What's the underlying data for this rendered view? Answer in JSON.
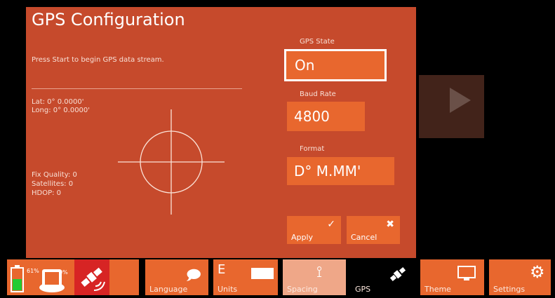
{
  "dialog": {
    "title": "GPS Configuration",
    "intro": "Press Start to begin GPS data stream.",
    "lat": "Lat: 0° 0.0000'",
    "long": "Long: 0° 0.0000'",
    "fix_quality": "Fix Quality: 0",
    "satellites": "Satellites: 0",
    "hdop": "HDOP: 0"
  },
  "fields": {
    "gps_state": {
      "label": "GPS State",
      "value": "On"
    },
    "baud_rate": {
      "label": "Baud Rate",
      "value": "4800"
    },
    "format": {
      "label": "Format",
      "value": "D° M.MM'"
    }
  },
  "buttons": {
    "apply": "Apply",
    "cancel": "Cancel"
  },
  "taskbar": {
    "battery_pct": "61%",
    "gps_pct": "0%",
    "language": "Language",
    "units": "Units",
    "units_letter": "E",
    "spacing": "Spacing",
    "gps": "GPS",
    "theme": "Theme",
    "settings": "Settings"
  },
  "colors": {
    "panel": "#c64a2c",
    "accent": "#e8672e",
    "background": "#000000"
  }
}
